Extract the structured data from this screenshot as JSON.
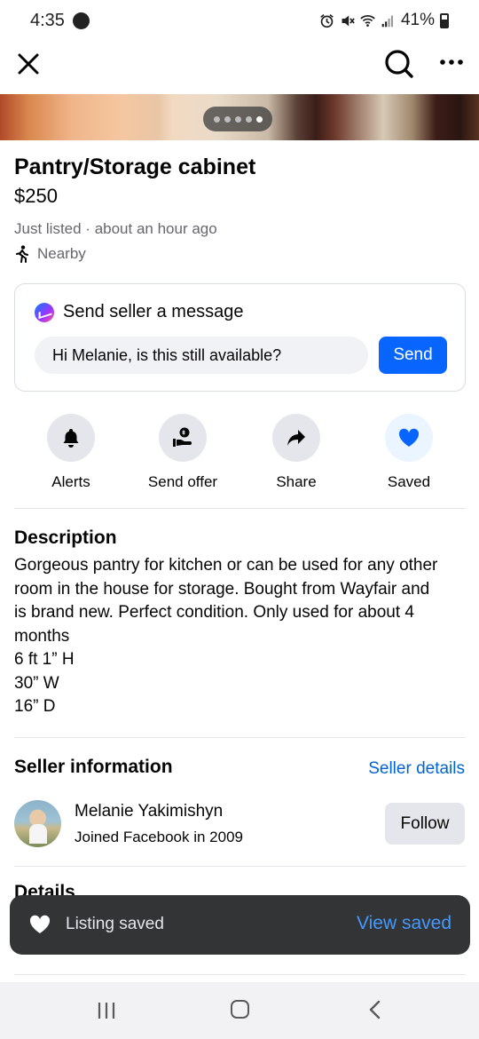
{
  "status_bar": {
    "time": "4:35",
    "battery": "41%"
  },
  "listing": {
    "title": "Pantry/Storage cabinet",
    "price": "$250",
    "listed": "Just listed · about an hour ago",
    "location": "Nearby",
    "photo_count": 5,
    "photo_active_index": 5
  },
  "message_card": {
    "heading": "Send seller a message",
    "input_value": "Hi Melanie, is this still available?",
    "send_label": "Send"
  },
  "actions": [
    {
      "label": "Alerts",
      "icon": "bell-icon"
    },
    {
      "label": "Send offer",
      "icon": "offer-icon"
    },
    {
      "label": "Share",
      "icon": "share-icon"
    },
    {
      "label": "Saved",
      "icon": "heart-icon"
    }
  ],
  "description": {
    "heading": "Description",
    "lines": [
      "Gorgeous pantry for kitchen or can be used for any other",
      "room in the house for storage. Bought from Wayfair and",
      "is brand new. Perfect condition. Only used for about 4",
      "months",
      "6 ft 1” H",
      "30” W",
      "16” D"
    ]
  },
  "seller": {
    "heading": "Seller information",
    "details_link": "Seller details",
    "name": "Melanie Yakimishyn",
    "joined": "Joined Facebook in 2009",
    "follow_label": "Follow"
  },
  "details": {
    "heading": "Details"
  },
  "toast": {
    "text": "Listing saved",
    "link": "View saved"
  },
  "colors": {
    "accent": "#0866ff",
    "link": "#0064d1",
    "toast_bg": "#323436",
    "toast_link": "#4599ff",
    "saved_heart": "#0866ff"
  }
}
